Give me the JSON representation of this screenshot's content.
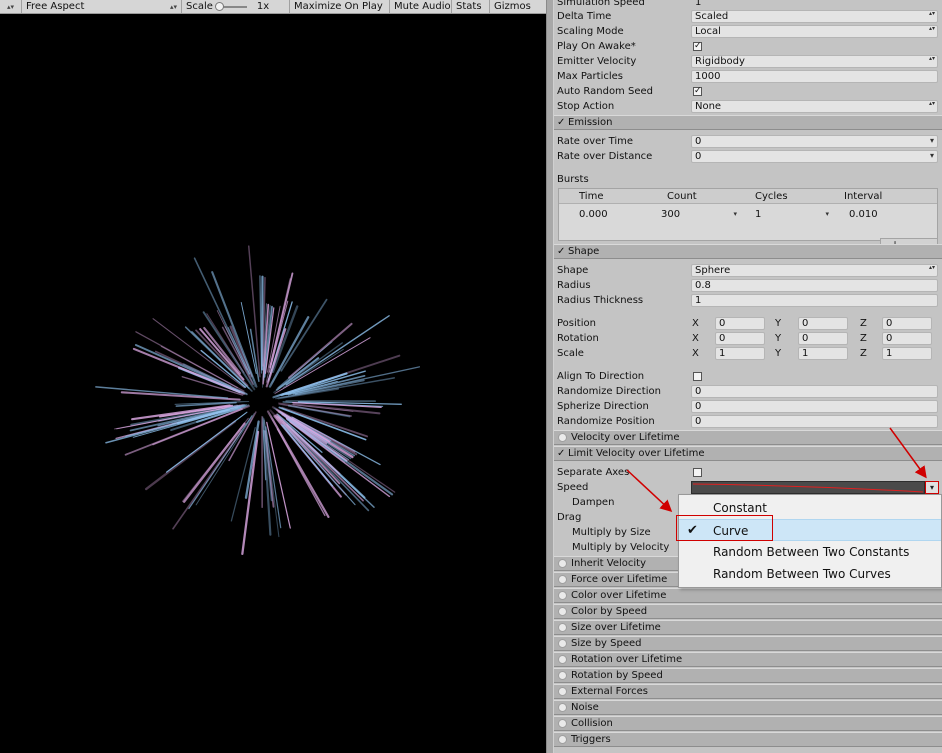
{
  "game_toolbar": {
    "aspect": "Free Aspect",
    "scale_label": "Scale",
    "scale_value": "1x",
    "maximize": "Maximize On Play",
    "mute": "Mute Audio",
    "stats": "Stats",
    "gizmos": "Gizmos"
  },
  "main": {
    "simulation_speed": {
      "label": "Simulation Speed",
      "value": "1"
    },
    "delta_time": {
      "label": "Delta Time",
      "value": "Scaled"
    },
    "scaling_mode": {
      "label": "Scaling Mode",
      "value": "Local"
    },
    "play_on_awake": {
      "label": "Play On Awake*",
      "checked": "✓"
    },
    "emitter_velocity": {
      "label": "Emitter Velocity",
      "value": "Rigidbody"
    },
    "max_particles": {
      "label": "Max Particles",
      "value": "1000"
    },
    "auto_random_seed": {
      "label": "Auto Random Seed",
      "checked": "✓"
    },
    "stop_action": {
      "label": "Stop Action",
      "value": "None"
    }
  },
  "emission": {
    "title": "Emission",
    "check": "✓",
    "rate_over_time": {
      "label": "Rate over Time",
      "value": "0"
    },
    "rate_over_distance": {
      "label": "Rate over Distance",
      "value": "0"
    },
    "bursts_label": "Bursts",
    "bursts_headers": [
      "Time",
      "Count",
      "Cycles",
      "Interval"
    ],
    "burst_row": {
      "time": "0.000",
      "count": "300",
      "cycles": "1",
      "interval": "0.010"
    },
    "add": "+",
    "remove": "−"
  },
  "shape": {
    "title": "Shape",
    "check": "✓",
    "shape": {
      "label": "Shape",
      "value": "Sphere"
    },
    "radius": {
      "label": "Radius",
      "value": "0.8"
    },
    "radius_thickness": {
      "label": "Radius Thickness",
      "value": "1"
    },
    "position": {
      "label": "Position",
      "x": "0",
      "y": "0",
      "z": "0"
    },
    "rotation": {
      "label": "Rotation",
      "x": "0",
      "y": "0",
      "z": "0"
    },
    "scale": {
      "label": "Scale",
      "x": "1",
      "y": "1",
      "z": "1"
    },
    "axis_x": "X",
    "axis_y": "Y",
    "axis_z": "Z",
    "align_to_direction": {
      "label": "Align To Direction"
    },
    "randomize_direction": {
      "label": "Randomize Direction",
      "value": "0"
    },
    "spherize_direction": {
      "label": "Spherize Direction",
      "value": "0"
    },
    "randomize_position": {
      "label": "Randomize Position",
      "value": "0"
    }
  },
  "velocity_over_lifetime": {
    "title": "Velocity over Lifetime"
  },
  "limit_velocity": {
    "title": "Limit Velocity over Lifetime",
    "check": "✓",
    "separate_axes": "Separate Axes",
    "speed": "Speed",
    "dampen": "Dampen",
    "drag": "Drag",
    "multiply_by_size": "Multiply by Size",
    "multiply_by_velocity": "Multiply by Velocity"
  },
  "modules": [
    "Inherit Velocity",
    "Force over Lifetime",
    "Color over Lifetime",
    "Color by Speed",
    "Size over Lifetime",
    "Size by Speed",
    "Rotation over Lifetime",
    "Rotation by Speed",
    "External Forces",
    "Noise",
    "Collision",
    "Triggers"
  ],
  "speed_menu": {
    "items": [
      "Constant",
      "Curve",
      "Random Between Two Constants",
      "Random Between Two Curves"
    ],
    "selected_index": 1,
    "check": "✔"
  },
  "colors": {
    "annotation_red": "#d00000",
    "particle_blue": "#8fc3f0",
    "particle_pink": "#d9a6e0",
    "curve_red": "#e02020"
  }
}
